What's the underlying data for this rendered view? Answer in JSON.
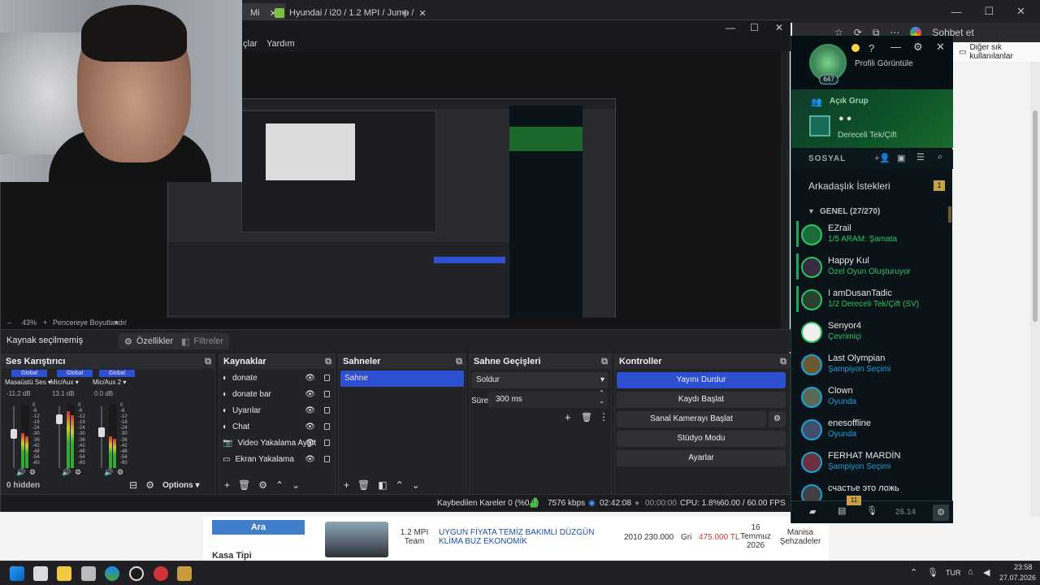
{
  "browser": {
    "tab1": "Mi",
    "tab2": "Hyundai / i20 / 1.2 MPI / Jump / ",
    "new_tab": "+",
    "toolbar_chat": "Sohbet et",
    "bookmarks_label": "Diğer sık kullanılanlar",
    "win_min": "—",
    "win_max": "☐",
    "win_close": "✕",
    "listing": {
      "search_button": "Ara",
      "engine": "1.2 MPI Team",
      "title": "UYGUN FİYATA TEMİZ BAKIMLI DÜZGÜN KLİMA BUZ EKONOMİK",
      "year": "2010",
      "km": "230.000",
      "color": "Gri",
      "price": "475.000 TL",
      "date": "16 Temmuz 2026",
      "location": "Manisa Şehzadeler",
      "side_label": "Kasa Tipi"
    }
  },
  "obs": {
    "menu_left": "çlar",
    "menu_help": "Yardım",
    "win_min": "—",
    "win_max": "☐",
    "win_close": "✕",
    "zoom": "43%",
    "zoom_minus": "–",
    "zoom_plus": "+",
    "resize_label": "Pencereye Boyutlandır",
    "no_source": "Kaynak seçilmemiş",
    "properties": "Özellikler",
    "filters": "Filtreler",
    "mixer": {
      "title": "Ses Karıştırıcı",
      "channels": [
        {
          "tag": "Global",
          "name": "Masaüstü Ses",
          "db": "-11.2 dB"
        },
        {
          "tag": "Global",
          "name": "Mic/Aux",
          "db": "13.1 dB"
        },
        {
          "tag": "Global",
          "name": "Mic/Aux 2",
          "db": "0.0 dB"
        }
      ],
      "scale": [
        "0",
        "-6",
        "-12",
        "-18",
        "-24",
        "-30",
        "-36",
        "-42",
        "-48",
        "-54",
        "-60"
      ],
      "hidden": "0 hidden",
      "options": "Options"
    },
    "sources": {
      "title": "Kaynaklar",
      "items": [
        "donate",
        "donate bar",
        "Uyarılar",
        "Chat",
        "Video Yakalama Aygıt",
        "Ekran Yakalama"
      ]
    },
    "scenes": {
      "title": "Sahneler",
      "items": [
        "Sahne"
      ]
    },
    "transitions": {
      "title": "Sahne Geçişleri",
      "type": "Soldur",
      "duration_label": "Süre",
      "duration": "300 ms"
    },
    "controls": {
      "title": "Kontroller",
      "stop_stream": "Yayını Durdur",
      "start_record": "Kaydı Başlat",
      "virtual_cam": "Sanal Kamerayı Başlat",
      "studio": "Stüdyo Modu",
      "settings": "Ayarlar"
    },
    "status": {
      "dropped": "Kaybedilen Kareler 0 (%0.0)",
      "bitrate": "7576 kbps",
      "stream_time": "02:42:08",
      "rec_time": "00:00:00",
      "cpu": "CPU: 1.8%",
      "fps": "60.00 / 60.00 FPS"
    }
  },
  "lol": {
    "profile": "Profili Görüntüle",
    "level": "647",
    "help": "?",
    "min": "—",
    "close": "✕",
    "group_title": "Açık Grup",
    "group_mode": "Dereceli Tek/Çift",
    "social": "SOSYAL",
    "requests": "Arkadaşlık İstekleri",
    "requests_count": "1",
    "general": "GENEL (27/270)",
    "friends": [
      {
        "name": "EZrail",
        "status": "1/5 ARAM: Şamata",
        "color": "#2ec464"
      },
      {
        "name": "Happy Kul",
        "status": "Özel Oyun Oluşturuyor",
        "color": "#2ec464"
      },
      {
        "name": "I amDusanTadic",
        "status": "1/2 Dereceli Tek/Çift (SV)",
        "color": "#2ec464"
      },
      {
        "name": "Senyor4",
        "status": "Çevrimiçi",
        "color": "#2ec464"
      },
      {
        "name": "Last Olympian",
        "status": "Şampiyon Seçimi",
        "color": "#1da1d9"
      },
      {
        "name": "Clown",
        "status": "Oyunda",
        "color": "#1da1d9"
      },
      {
        "name": "enesoffline",
        "status": "Oyunda",
        "color": "#1da1d9"
      },
      {
        "name": "FERHAT MARDİN",
        "status": "Şampiyon Seçimi",
        "color": "#1da1d9"
      },
      {
        "name": "счастье это ложь",
        "status": "",
        "color": "#1da1d9"
      }
    ],
    "footer_badge": "11",
    "footer_version": "26.14"
  },
  "taskbar": {
    "lang": "TUR",
    "time": "23:58",
    "date": "27.07.2026"
  }
}
